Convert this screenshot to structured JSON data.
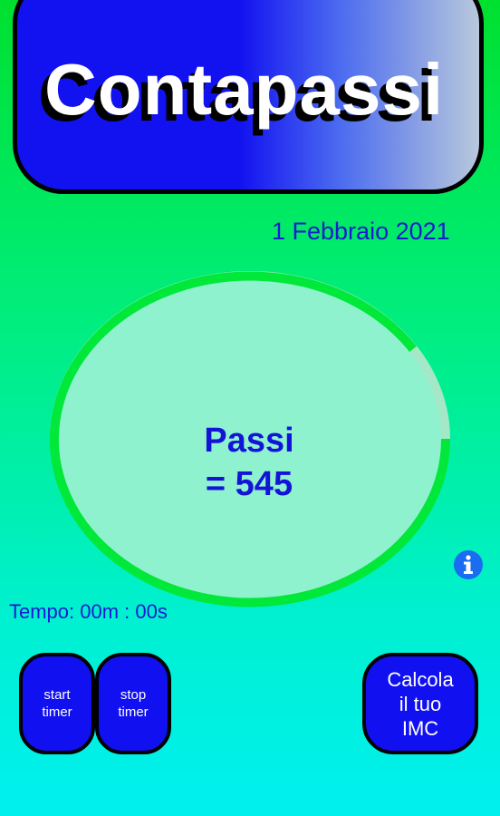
{
  "header": {
    "title": "Contapassi"
  },
  "date": "1 Febbraio 2021",
  "counter": {
    "label": "Passi",
    "value": "= 545"
  },
  "timer": {
    "text": "Tempo: 00m : 00s"
  },
  "buttons": {
    "start": [
      "start",
      "timer"
    ],
    "stop": [
      "stop",
      "timer"
    ],
    "imc": [
      "Calcola",
      "il tuo",
      "IMC"
    ]
  },
  "icons": {
    "info": "info-icon"
  },
  "colors": {
    "accent": "#1010f0",
    "text_blue": "#1a1ad0",
    "progress": "#00e83a",
    "gauge_fill": "#8ef2cf"
  }
}
